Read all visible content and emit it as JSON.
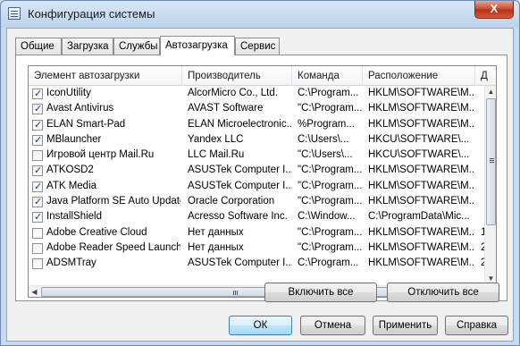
{
  "window": {
    "title": "Конфигурация системы",
    "close_glyph": "X"
  },
  "tabs": [
    {
      "label": "Общие"
    },
    {
      "label": "Загрузка"
    },
    {
      "label": "Службы"
    },
    {
      "label": "Автозагрузка",
      "active": true
    },
    {
      "label": "Сервис"
    }
  ],
  "startup_list": {
    "columns": [
      "Элемент автозагрузки",
      "Производитель",
      "Команда",
      "Расположение",
      "Д"
    ],
    "rows": [
      {
        "checked": true,
        "name": "IconUtility",
        "maker": "AlcorMicro Co., Ltd.",
        "command": "C:\\Program...",
        "location": "HKLM\\SOFTWARE\\M...",
        "extra": ""
      },
      {
        "checked": true,
        "name": "Avast Antivirus",
        "maker": "AVAST Software",
        "command": "\"C:\\Program...",
        "location": "HKLM\\SOFTWARE\\M...",
        "extra": ""
      },
      {
        "checked": true,
        "name": "ELAN Smart-Pad",
        "maker": "ELAN Microelectronic...",
        "command": "%Program...",
        "location": "HKLM\\SOFTWARE\\M...",
        "extra": ""
      },
      {
        "checked": true,
        "name": "MBlauncher",
        "maker": "Yandex LLC",
        "command": "C:\\Users\\...",
        "location": "HKCU\\SOFTWARE\\...",
        "extra": ""
      },
      {
        "checked": false,
        "name": "Игровой центр Mail.Ru",
        "maker": "LLC Mail.Ru",
        "command": "\"C:\\Users\\...",
        "location": "HKCU\\SOFTWARE\\...",
        "extra": ""
      },
      {
        "checked": true,
        "name": "ATKOSD2",
        "maker": "ASUSTek Computer I...",
        "command": "\"C:\\Program...",
        "location": "HKLM\\SOFTWARE\\M...",
        "extra": ""
      },
      {
        "checked": true,
        "name": "ATK Media",
        "maker": "ASUSTek Computer I...",
        "command": "\"C:\\Program...",
        "location": "HKLM\\SOFTWARE\\M...",
        "extra": ""
      },
      {
        "checked": true,
        "name": "Java Platform SE Auto Updater",
        "maker": "Oracle Corporation",
        "command": "\"C:\\Program...",
        "location": "HKLM\\SOFTWARE\\M...",
        "extra": ""
      },
      {
        "checked": true,
        "name": "InstallShield",
        "maker": "Acresso Software Inc.",
        "command": "C:\\Window...",
        "location": "C:\\ProgramData\\Mic...",
        "extra": ""
      },
      {
        "checked": false,
        "name": "Adobe Creative Cloud",
        "maker": "Нет данных",
        "command": "\"C:\\Program...",
        "location": "HKLM\\SOFTWARE\\M...",
        "extra": "1"
      },
      {
        "checked": false,
        "name": "Adobe Reader Speed Launcher",
        "maker": "Нет данных",
        "command": "\"C:\\Program...",
        "location": "HKLM\\SOFTWARE\\M...",
        "extra": "2"
      },
      {
        "checked": false,
        "name": "ADSMTray",
        "maker": "ASUSTek Computer I...",
        "command": "C:\\Program...",
        "location": "HKLM\\SOFTWARE\\M...",
        "extra": "2"
      }
    ],
    "vertical_scroll": {
      "up_glyph": "▲",
      "down_glyph": "▼"
    },
    "horizontal_scroll": {
      "left_glyph": "◀",
      "right_glyph": "▶"
    }
  },
  "actions": {
    "enable_all": "Включить все",
    "disable_all": "Отключить все"
  },
  "footer": {
    "ok": "ОК",
    "cancel": "Отмена",
    "apply": "Применить",
    "help": "Справка"
  }
}
